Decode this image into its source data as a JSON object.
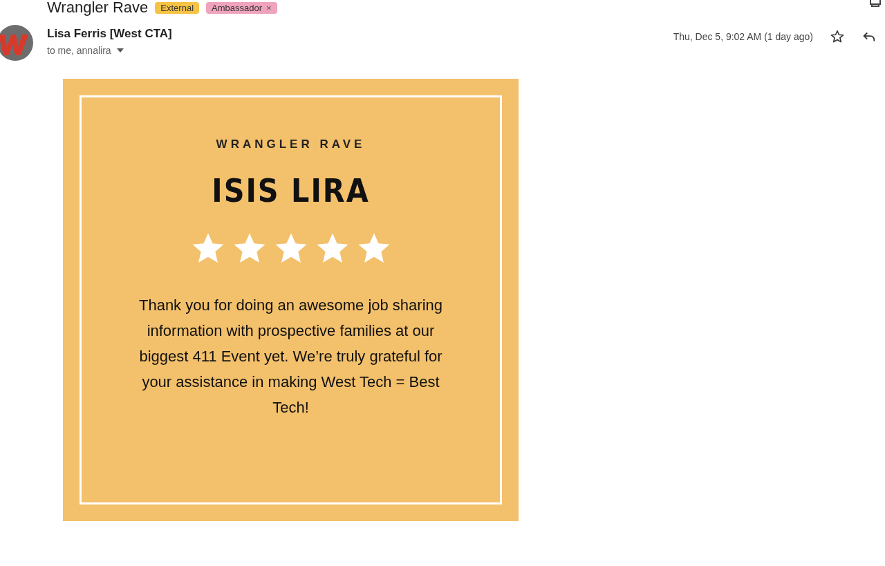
{
  "subject": {
    "title": "Wrangler Rave",
    "labels": [
      {
        "text": "External",
        "color": "#f6c344"
      },
      {
        "text": "Ambassador",
        "color": "#f0a3bd",
        "remove": "×"
      }
    ]
  },
  "message": {
    "sender": "Lisa Ferris [West CTA]",
    "recipients": "to me, annalira",
    "date": "Thu, Dec 5, 9:02 AM (1 day ago)",
    "starred": false
  },
  "card": {
    "heading": "WRANGLER RAVE",
    "name": "ISIS LIRA",
    "stars": 5,
    "body": "Thank you for doing an awesome job sharing information with prospective families at our biggest 411 Event yet. We’re truly grateful for your assistance in making West Tech = Best Tech!"
  }
}
